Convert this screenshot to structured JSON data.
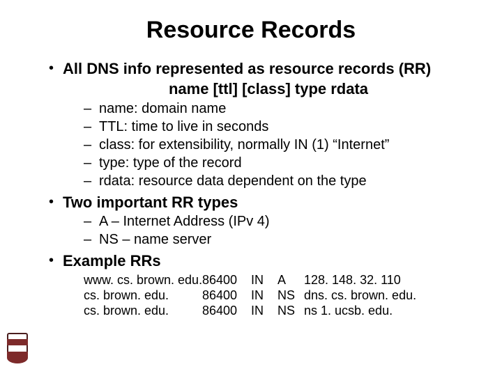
{
  "title": "Resource Records",
  "bullet1": "All DNS  info represented as resource records (RR)",
  "syntax": "name [ttl] [class] type rdata",
  "fields": {
    "f0": "name: domain name",
    "f1": "TTL: time to live in seconds",
    "f2": "class: for extensibility, normally IN (1) “Internet”",
    "f3": "type: type of the record",
    "f4": "rdata: resource data dependent on the type"
  },
  "bullet2": "Two important RR types",
  "rrtypes": {
    "t0": "A – Internet Address (IPv 4)",
    "t1": "NS – name server"
  },
  "bullet3": "Example RRs",
  "examples": {
    "r0": {
      "name": "www. cs. brown. edu.",
      "ttl": "86400",
      "class": "IN",
      "type": "A",
      "rdata": "128. 148. 32. 110"
    },
    "r1": {
      "name": "cs. brown. edu.",
      "ttl": "86400",
      "class": "IN",
      "type": "NS",
      "rdata": "dns. cs. brown. edu."
    },
    "r2": {
      "name": "cs. brown. edu.",
      "ttl": "86400",
      "class": "IN",
      "type": "NS",
      "rdata": "ns 1. ucsb. edu."
    }
  }
}
